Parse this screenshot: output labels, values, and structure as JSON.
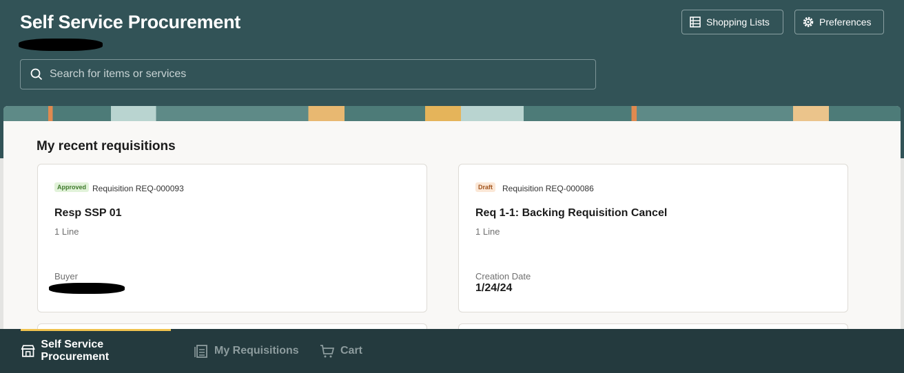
{
  "header": {
    "title": "Self Service Procurement",
    "search_placeholder": "Search for items or services",
    "shopping_lists": "Shopping Lists",
    "preferences": "Preferences"
  },
  "section": {
    "title": "My recent requisitions"
  },
  "cards": [
    {
      "status": "Approved",
      "status_color": "#3f7a2c",
      "status_bg": "#e1f2d9",
      "requisition": "Requisition REQ-000093",
      "title": "Resp SSP 01",
      "lines": "1 Line",
      "field_label": "Buyer"
    },
    {
      "status": "Draft",
      "status_color": "#a0541e",
      "status_bg": "#fbe7d6",
      "requisition": "Requisition REQ-000086",
      "title": "Req 1-1: Backing Requisition Cancel",
      "lines": "1 Line",
      "field_label": "Creation Date",
      "field_value": "1/24/24"
    }
  ],
  "nav": {
    "items": [
      {
        "label": "Self Service Procurement"
      },
      {
        "label": "My Requisitions"
      },
      {
        "label": "Cart"
      }
    ]
  }
}
